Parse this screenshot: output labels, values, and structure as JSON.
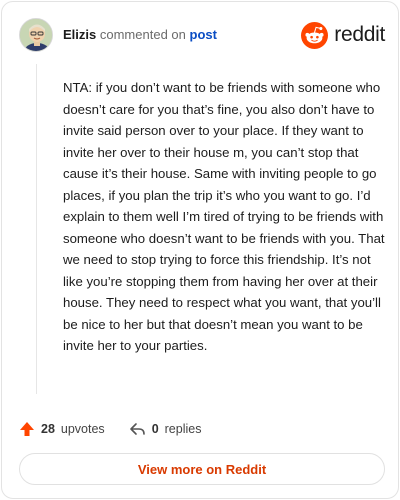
{
  "comment": {
    "author": "Elizis",
    "action_text": "commented on",
    "target_link": "post",
    "body": "NTA: if you don’t want to be friends with someone who doesn’t care for you that’s fine, you also don’t have to invite said person over to your place. If they want to invite her over to their house m, you can’t stop that cause it’s their house. Same with inviting people to go places, if you plan the trip it’s who you want to go. I’d explain to them well I’m tired of trying to be friends with someone who doesn’t want to be friends with you. That we need to stop trying to force this friendship. It’s not like you’re stopping them from having her over at their house. They need to respect what you want, that you’ll be nice to her but that doesn’t mean you want to be invite her to your parties."
  },
  "brand": {
    "name": "reddit",
    "icon": "reddit-snoo-icon",
    "color": "#ff4500"
  },
  "actions": {
    "upvotes_count": "28",
    "upvotes_label": "upvotes",
    "upvote_icon": "upvote-arrow-icon",
    "upvote_color": "#ff4500",
    "replies_count": "0",
    "replies_label": "replies",
    "reply_icon": "reply-arrow-icon"
  },
  "cta": {
    "label": "View more on Reddit",
    "color": "#d93a00"
  }
}
